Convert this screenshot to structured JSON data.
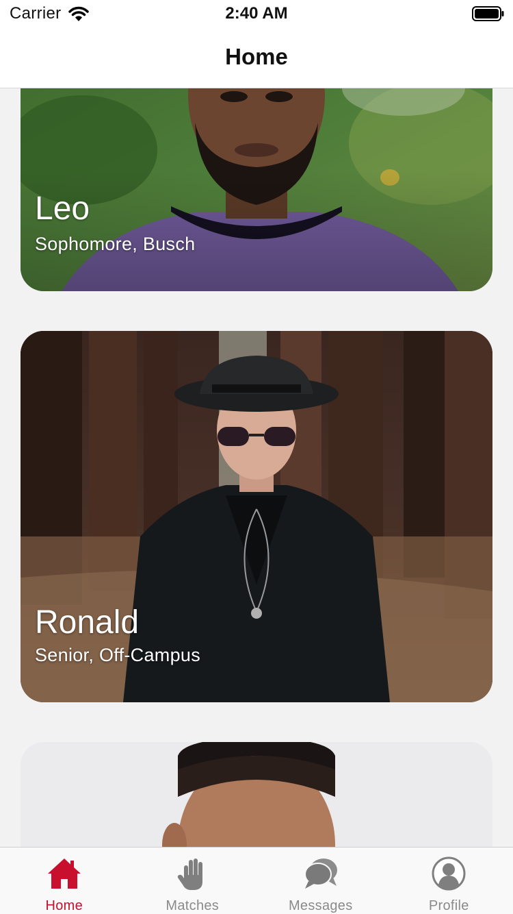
{
  "status_bar": {
    "carrier": "Carrier",
    "time": "2:40 AM"
  },
  "nav": {
    "title": "Home"
  },
  "cards": [
    {
      "name": "Leo",
      "detail": "Sophomore, Busch"
    },
    {
      "name": "Ronald",
      "detail": "Senior, Off-Campus"
    },
    {
      "name": "",
      "detail": ""
    }
  ],
  "tabs": [
    {
      "label": "Home",
      "icon": "home-icon",
      "active": true
    },
    {
      "label": "Matches",
      "icon": "hand-icon",
      "active": false
    },
    {
      "label": "Messages",
      "icon": "chat-bubbles-icon",
      "active": false
    },
    {
      "label": "Profile",
      "icon": "profile-icon",
      "active": false
    }
  ],
  "colors": {
    "accent": "#c8102e",
    "inactive": "#8a8a8a",
    "background": "#f2f2f2"
  }
}
